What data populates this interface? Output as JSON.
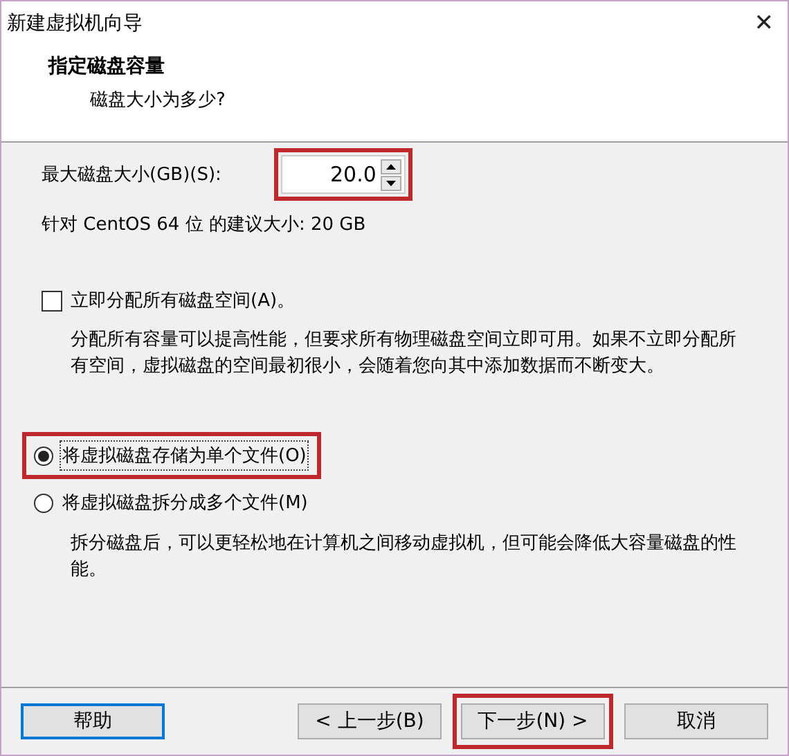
{
  "window": {
    "title": "新建虚拟机向导",
    "close": "✕"
  },
  "header": {
    "title": "指定磁盘容量",
    "subtitle": "磁盘大小为多少?"
  },
  "disk_size": {
    "label": "最大磁盘大小(GB)(S):",
    "value": "20.0",
    "highlighted": true
  },
  "recommendation": "针对 CentOS 64 位 的建议大小: 20 GB",
  "allocate": {
    "label": "立即分配所有磁盘空间(A)。",
    "checked": false,
    "description": "分配所有容量可以提高性能，但要求所有物理磁盘空间立即可用。如果不立即分配所有空间，虚拟磁盘的空间最初很小，会随着您向其中添加数据而不断变大。"
  },
  "storage_options": [
    {
      "label": "将虚拟磁盘存储为单个文件(O)",
      "selected": true,
      "highlighted": true
    },
    {
      "label": "将虚拟磁盘拆分成多个文件(M)",
      "selected": false,
      "highlighted": false,
      "description": "拆分磁盘后，可以更轻松地在计算机之间移动虚拟机，但可能会降低大容量磁盘的性能。"
    }
  ],
  "buttons": [
    {
      "label": "帮助",
      "kind": "help",
      "highlighted": false
    },
    {
      "label": "< 上一步(B)",
      "kind": "nav",
      "highlighted": false
    },
    {
      "label": "下一步(N) >",
      "kind": "nav",
      "highlighted": true
    },
    {
      "label": "取消",
      "kind": "nav",
      "highlighted": false
    }
  ]
}
